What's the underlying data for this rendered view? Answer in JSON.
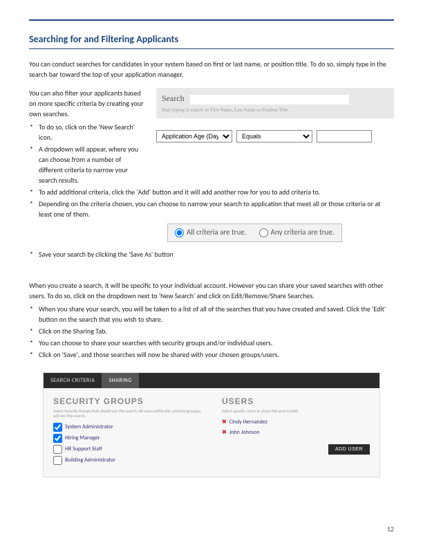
{
  "heading": "Searching for and Filtering Applicants",
  "intro": "You can conduct searches for candidates in your system based on first or last name, or position title. To do so, simply type in the search bar toward the top of your application manager.",
  "filter_intro": "You can also filter your applicants based on more specific criteria by creating your own searches.",
  "search_widget": {
    "label": "Search",
    "hint": "Start typing to search on First Name, Last Name or Position Title"
  },
  "bullets1": [
    "To do so, click on the 'New Search' icon.",
    "A dropdown will appear, where you can choose from a number of different criteria to narrow your search results."
  ],
  "criteria": {
    "field": "Application Age (Days)",
    "operator": "Equals",
    "value": ""
  },
  "bullets2": [
    "To add additional criteria, click the 'Add' button and it will add another row for you to add criteria to.",
    "Depending on the criteria chosen, you can choose to narrow your search to application that meet all or those criteria or at least one of them."
  ],
  "radios": {
    "all": "All criteria are true.",
    "any": "Any criteria are true."
  },
  "bullets3": [
    "Save your search by clicking the 'Save As' button"
  ],
  "share_intro": "When you create a search, it will be specific to your individual account. However you can share your saved searches with other users. To do so, click on the dropdown next to 'New Search' and click on Edit/Remove/Share Searches.",
  "share_bullets": [
    "When you share your search, you will be taken to a list of all of the searches that you have created and saved. Click the 'Edit' button on the search that you wish to share.",
    "Click on the Sharing Tab.",
    "You can choose to share your searches with security groups and/or individual users.",
    "Click on 'Save', and those searches will now be shared with your chosen groups/users."
  ],
  "sharing_panel": {
    "tabs": {
      "criteria": "SEARCH CRITERIA",
      "sharing": "SHARING"
    },
    "security_groups": {
      "title": "SECURITY GROUPS",
      "sub": "Select Security Groups that should see this search. All users within the selected group(s) will see this search.",
      "items": [
        {
          "label": "System Administrator",
          "checked": true
        },
        {
          "label": "Hiring Manager",
          "checked": true
        },
        {
          "label": "HR Support Staff",
          "checked": false
        },
        {
          "label": "Building Administrator",
          "checked": false
        }
      ]
    },
    "users": {
      "title": "USERS",
      "sub": "Select specific Users to share this search with.",
      "items": [
        "Cindy Hernandez",
        "John Johnson"
      ],
      "add_btn": "ADD USER"
    }
  },
  "page_number": "12"
}
